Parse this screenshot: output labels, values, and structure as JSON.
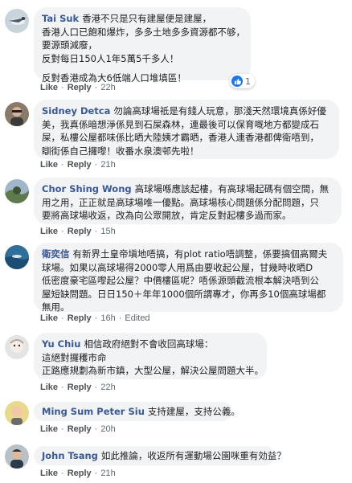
{
  "comments": [
    {
      "author": "Tai Suk",
      "lines": [
        "香港不只是只有建屋便是建屋，",
        "香港人口已飽和爆炸，多多土地多多資源都不够，",
        "要源頭減廢，",
        "反對每日150人1年5萬5千多人！",
        "",
        "反對香港成為大6低端人口堆填區！"
      ],
      "like": "Like",
      "reply": "Reply",
      "time": "22h",
      "reactions": "1",
      "avatar_icon": "bird-avatar-icon"
    },
    {
      "author": "Sidney Detca",
      "lines": [
        "勿論高球場祗是有錢人玩意，那淺天然環境真係好優",
        "美，我真係暗想淨係見到石屎森林，連最後可以保育嘅地方都變成石",
        "屎，私樓公屋都味係比晒大陸姨才霸晒，香港人連香港都俾衛唔到，",
        "瞓街係自己攞嚟！收番水泉澳邨先啦！"
      ],
      "like": "Like",
      "reply": "Reply",
      "time": "21h",
      "avatar_icon": "person-avatar-icon"
    },
    {
      "author": "Chor Shing Wong",
      "lines": [
        "高球場喺應該起樓，有高球場起碼有個空間，無",
        "用之用，正正就是高球場唯一優點。高球場核心問題係分配問題，只",
        "要將高球場收返，改為向公眾開放，肯定反對起樓多過而家。"
      ],
      "like": "Like",
      "reply": "Reply",
      "time": "15h",
      "avatar_icon": "landscape-avatar-icon"
    },
    {
      "author": "衛奕信",
      "lines": [
        "有新界土皇帝塡地唔搞，有plot ratio唔調整，係要搞個高爾夫",
        "球場。如果以高球場得2000零人用爲由要收起公屋，甘幾時收晒D",
        "低密度豪宅區嚟起公屋？中價樓區呢？唔係源頭截流根本解決唔到公",
        "屋短缺問題。日日150＋年年1000個所謂專才，你再多10個高球場都",
        "無用。"
      ],
      "like": "Like",
      "reply": "Reply",
      "time": "16h",
      "edited": "Edited",
      "avatar_icon": "sea-avatar-icon"
    },
    {
      "author": "Yu Chiu",
      "lines": [
        "相信政府絕對不會收回高球場：",
        "這絕對攞穫市命",
        "正路應規劃為新市鎮，大型公屋，解決公屋問題大半。"
      ],
      "like": "Like",
      "reply": "Reply",
      "time": "22h",
      "avatar_icon": "doll-avatar-icon"
    },
    {
      "author": "Ming Sum Peter Siu",
      "lines": [
        "支持建屋，支持公義。"
      ],
      "like": "Like",
      "reply": "Reply",
      "time": "20h",
      "avatar_icon": "bald-avatar-icon"
    },
    {
      "author": "John Tsang",
      "lines": [
        "如此推論，收返所有運動場公園咪重有効益？"
      ],
      "like": "Like",
      "reply": "Reply",
      "time": "21h",
      "avatar_icon": "man-avatar-icon"
    }
  ],
  "colors": {
    "name": "#385898",
    "bubble": "#f2f3f5",
    "like_blue": "#1877f2"
  }
}
